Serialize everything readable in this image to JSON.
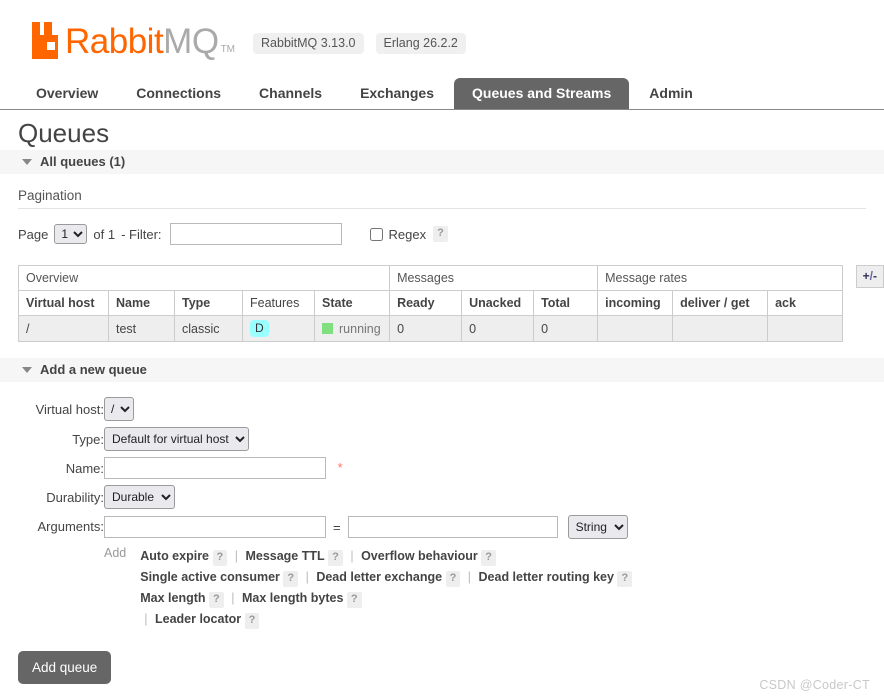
{
  "header": {
    "logo_rabbit": "Rabbit",
    "logo_mq": "MQ",
    "trademark": "TM",
    "version_rabbitmq": "RabbitMQ 3.13.0",
    "version_erlang": "Erlang 26.2.2",
    "brand_color": "#ff6600"
  },
  "nav": {
    "tabs": [
      {
        "label": "Overview",
        "active": false
      },
      {
        "label": "Connections",
        "active": false
      },
      {
        "label": "Channels",
        "active": false
      },
      {
        "label": "Exchanges",
        "active": false
      },
      {
        "label": "Queues and Streams",
        "active": true
      },
      {
        "label": "Admin",
        "active": false
      }
    ]
  },
  "page": {
    "title": "Queues"
  },
  "all_queues": {
    "section_label": "All queues (1)",
    "pagination_heading": "Pagination",
    "page_label": "Page",
    "page_value": "1",
    "page_options": [
      "1"
    ],
    "of_label": "of 1",
    "filter_label": "- Filter:",
    "filter_value": "",
    "regex_label": "Regex",
    "regex_checked": false,
    "help_glyph": "?",
    "plus_minus_label": "+/-"
  },
  "table": {
    "group_headers": [
      {
        "label": "Overview",
        "span": 5
      },
      {
        "label": "Messages",
        "span": 3
      },
      {
        "label": "Message rates",
        "span": 3
      }
    ],
    "columns": [
      {
        "label": "Virtual host",
        "bold": true,
        "align": "left"
      },
      {
        "label": "Name",
        "bold": true,
        "align": "left"
      },
      {
        "label": "Type",
        "bold": true,
        "align": "left"
      },
      {
        "label": "Features",
        "bold": false,
        "align": "center"
      },
      {
        "label": "State",
        "bold": true,
        "align": "left"
      },
      {
        "label": "Ready",
        "bold": true,
        "align": "right"
      },
      {
        "label": "Unacked",
        "bold": true,
        "align": "right"
      },
      {
        "label": "Total",
        "bold": true,
        "align": "right"
      },
      {
        "label": "incoming",
        "bold": true,
        "align": "left"
      },
      {
        "label": "deliver / get",
        "bold": true,
        "align": "left"
      },
      {
        "label": "ack",
        "bold": true,
        "align": "left"
      }
    ],
    "rows": [
      {
        "virtual_host": "/",
        "name": "test",
        "type": "classic",
        "features": "D",
        "state": "running",
        "ready": "0",
        "unacked": "0",
        "total": "0",
        "incoming": "",
        "deliver_get": "",
        "ack": ""
      }
    ],
    "feature_badge_color": "#99ffff",
    "state_indicator_color": "#80e080"
  },
  "add_queue": {
    "section_label": "Add a new queue",
    "labels": {
      "virtual_host": "Virtual host:",
      "type": "Type:",
      "name": "Name:",
      "durability": "Durability:",
      "arguments": "Arguments:"
    },
    "virtual_host_value": "/",
    "virtual_host_options": [
      "/"
    ],
    "type_value": "Default for virtual host",
    "type_options": [
      "Default for virtual host"
    ],
    "name_value": "",
    "required_marker": "*",
    "durability_value": "Durable",
    "durability_options": [
      "Durable"
    ],
    "argument_key_value": "",
    "argument_value_value": "",
    "equals_sign": "=",
    "argument_type_value": "String",
    "argument_type_options": [
      "String"
    ],
    "add_link_label": "Add",
    "presets": [
      [
        "Auto expire",
        "Message TTL",
        "Overflow behaviour"
      ],
      [
        "Single active consumer",
        "Dead letter exchange",
        "Dead letter routing key"
      ],
      [
        "Max length",
        "Max length bytes"
      ],
      [
        "Leader locator"
      ]
    ],
    "help_glyph": "?",
    "separator": "|",
    "submit_label": "Add queue"
  },
  "watermark": {
    "text": "CSDN @Coder-CT"
  }
}
